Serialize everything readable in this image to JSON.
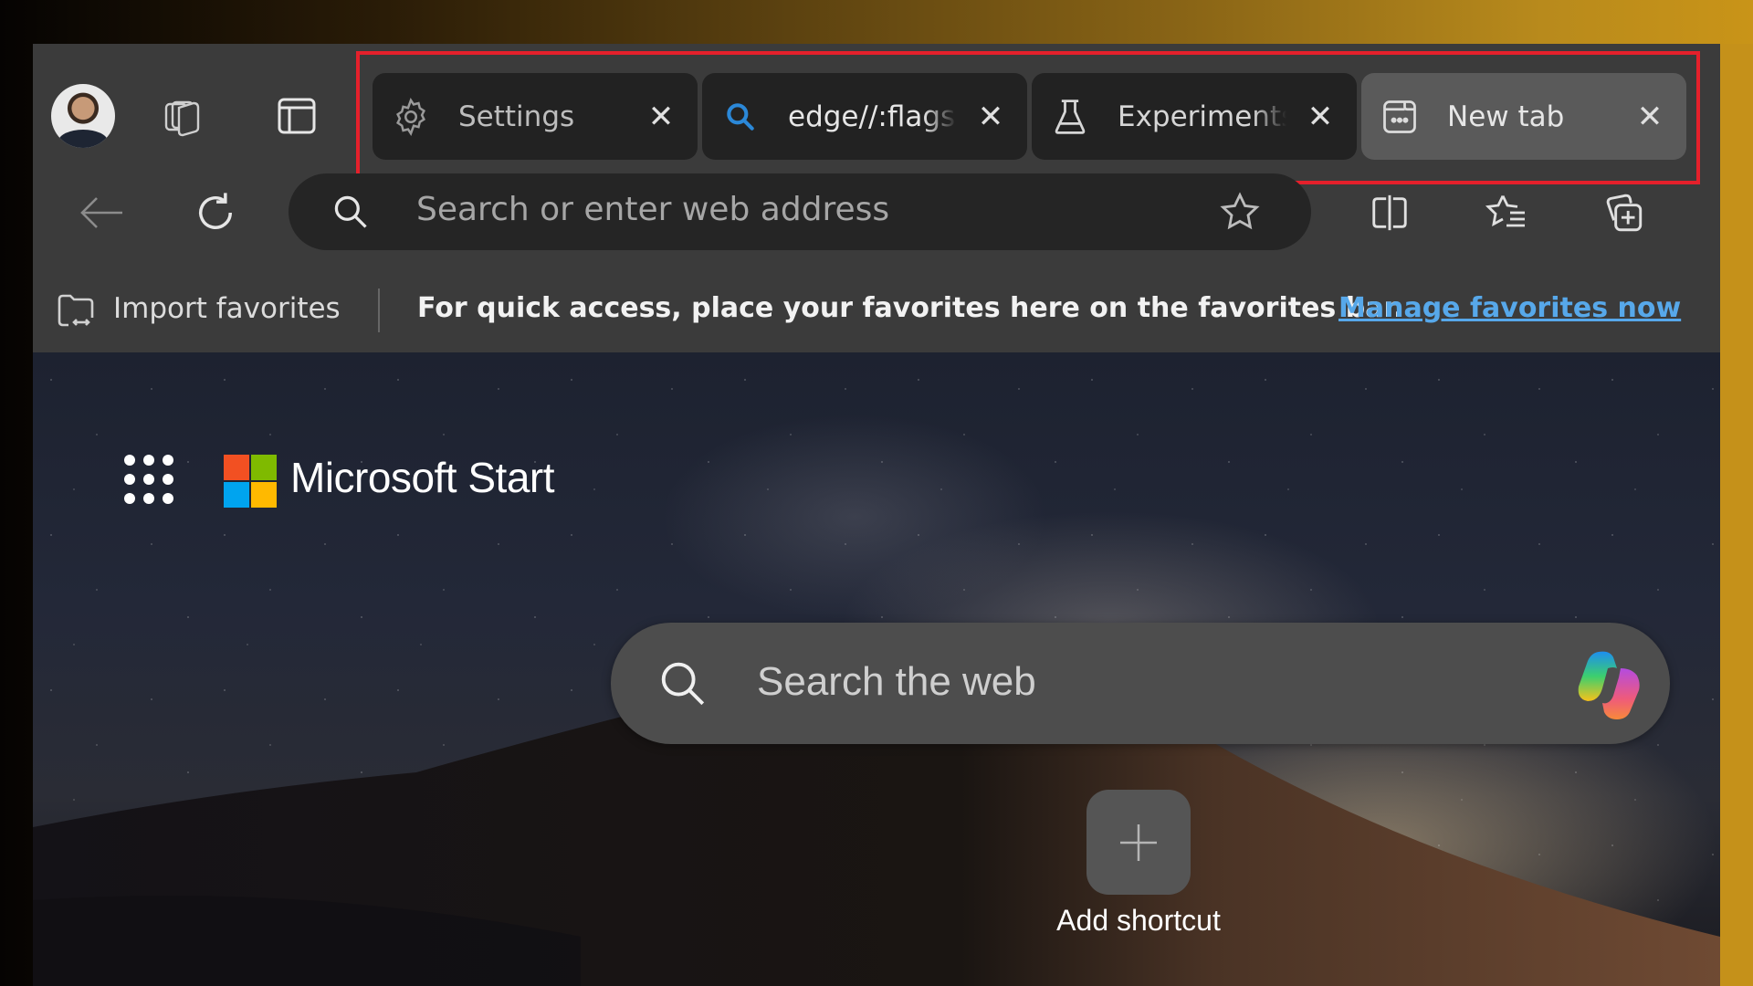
{
  "browser": {
    "profile_avatar_alt": "Profile",
    "toolbar_left_icons": [
      "workspaces-icon",
      "vertical-tabs-icon"
    ],
    "tabs": [
      {
        "label": "Settings",
        "icon": "gear-icon",
        "active": false
      },
      {
        "label": "edge//:flags",
        "icon": "search-icon",
        "active": false
      },
      {
        "label": "Experiments",
        "icon": "flask-icon",
        "active": false
      },
      {
        "label": "New tab",
        "icon": "new-tab-page-icon",
        "active": true
      }
    ],
    "close_glyph": "✕",
    "address_bar": {
      "placeholder": "Search or enter web address",
      "value": ""
    },
    "toolbar_right_icons": [
      "split-screen-icon",
      "favorites-icon",
      "collections-icon"
    ]
  },
  "favorites_bar": {
    "import_label": "Import favorites",
    "message": "For quick access, place your favorites here on the favorites bar.",
    "link": "Manage favorites now"
  },
  "new_tab_page": {
    "brand": "Microsoft Start",
    "logo_colors": [
      "#f25022",
      "#7fba00",
      "#00a4ef",
      "#ffb900"
    ],
    "search_placeholder": "Search the web",
    "shortcut_label": "Add shortcut",
    "shortcut_glyph": "+"
  },
  "annotation": {
    "highlight_color": "#e5202b",
    "highlight_target": "tab-strip"
  },
  "colors": {
    "link": "#57a8ea",
    "search_icon_accent": "#2b88d8"
  }
}
